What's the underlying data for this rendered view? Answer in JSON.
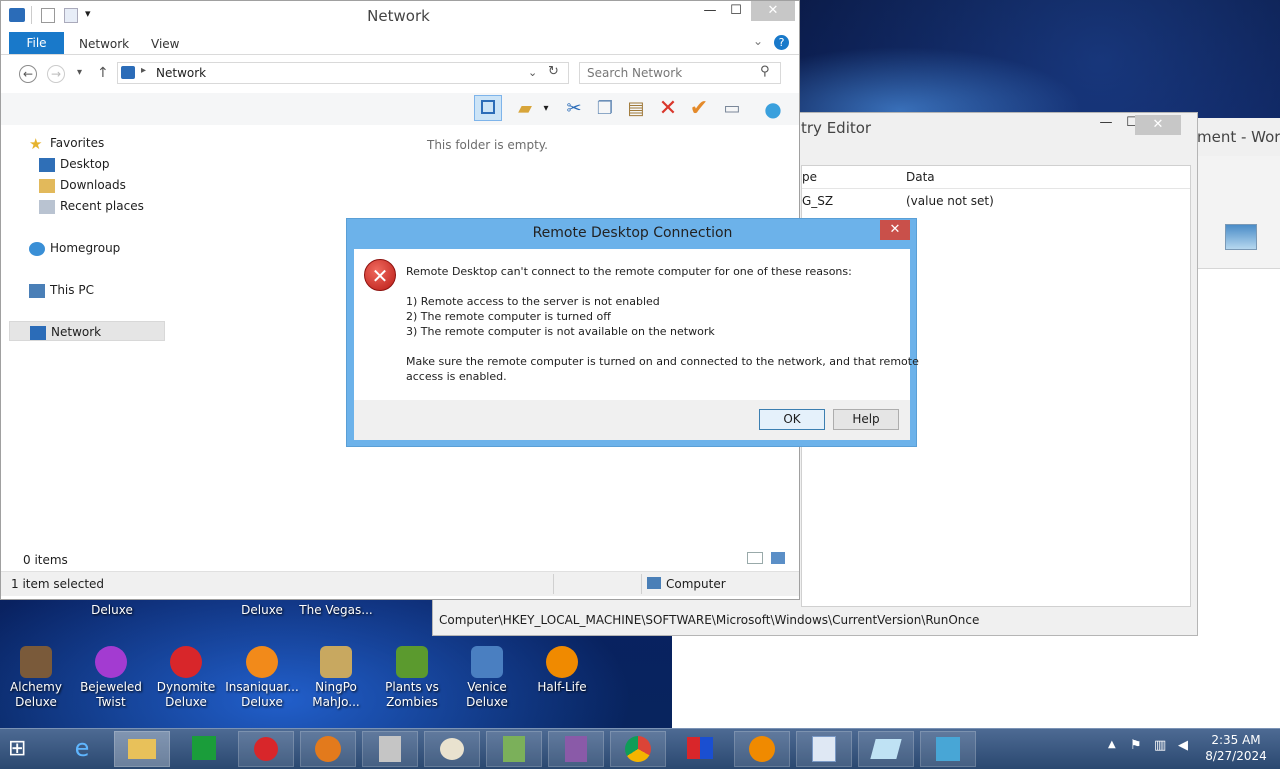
{
  "explorer": {
    "qat_dropdown": "▾",
    "title": "Network",
    "controls": {
      "minimize": "—",
      "maximize": "☐",
      "close": "✕"
    },
    "tabs": [
      "File",
      "Network",
      "View"
    ],
    "address": {
      "location": "Network",
      "search_placeholder": "Search Network"
    },
    "content_message": "This folder is empty.",
    "nav": {
      "favorites": "Favorites",
      "desktop": "Desktop",
      "downloads": "Downloads",
      "recent": "Recent places",
      "homegroup": "Homegroup",
      "thispc": "This PC",
      "network": "Network"
    },
    "status": {
      "items": "0 items",
      "selected": "1 item selected",
      "zone": "Computer"
    }
  },
  "regedit": {
    "title": "try Editor",
    "col_type": "pe",
    "col_data": "Data",
    "row_type": "G_SZ",
    "row_data": "(value not set)",
    "statusbar": "Computer\\HKEY_LOCAL_MACHINE\\SOFTWARE\\Microsoft\\Windows\\CurrentVersion\\RunOnce"
  },
  "word": {
    "title": "ment - Word"
  },
  "dialog": {
    "title": "Remote Desktop Connection",
    "close": "✕",
    "message": "Remote Desktop can't connect to the remote computer for one of these reasons:",
    "reason1": "1) Remote access to the server is not enabled",
    "reason2": "2) The remote computer is turned off",
    "reason3": "3) The remote computer is not available on the network",
    "advice1": "Make sure the remote computer is turned on and connected to the network, and that remote",
    "advice2": "access is enabled.",
    "ok": "OK",
    "help": "Help"
  },
  "desktop_icons_top": [
    "Deluxe",
    "Deluxe",
    "The Vegas..."
  ],
  "desktop_icons": [
    {
      "line1": "Alchemy",
      "line2": "Deluxe",
      "color": "#7a5a3a"
    },
    {
      "line1": "Bejeweled",
      "line2": "Twist",
      "color": "#a33bd1"
    },
    {
      "line1": "Dynomite",
      "line2": "Deluxe",
      "color": "#d8262a"
    },
    {
      "line1": "Insaniquar...",
      "line2": "Deluxe",
      "color": "#f28a1a"
    },
    {
      "line1": "NingPo",
      "line2": "MahJo...",
      "color": "#c8a860"
    },
    {
      "line1": "Plants vs",
      "line2": "Zombies",
      "color": "#5b9a2e"
    },
    {
      "line1": "Venice",
      "line2": "Deluxe",
      "color": "#4a7fc1"
    },
    {
      "line1": "Half-Life",
      "line2": "",
      "color": "#f08a00"
    }
  ],
  "taskbar": {
    "time": "2:35 AM",
    "date": "8/27/2024"
  }
}
